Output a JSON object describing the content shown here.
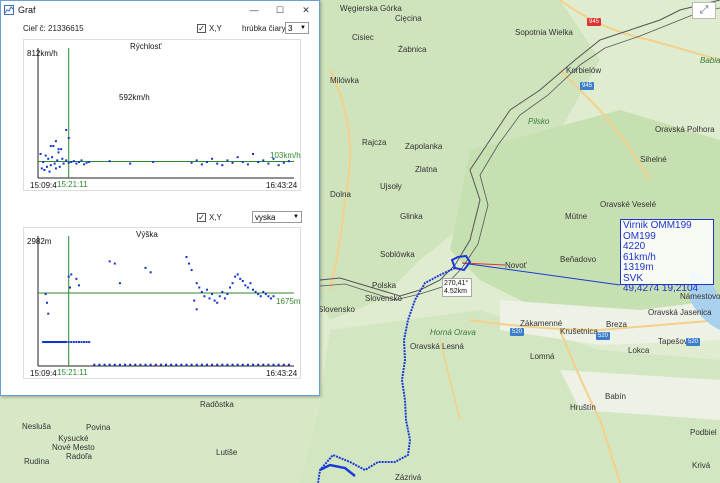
{
  "window": {
    "title": "Graf",
    "buttons": {
      "minimize": "—",
      "maximize": "☐",
      "close": "✕"
    }
  },
  "top_controls": {
    "target_label": "Cieľ č: 21336615",
    "xy_checkbox_label": "X,Y",
    "xy_checked": true,
    "line_width_label": "hrúbka čiary",
    "line_width_value": "3"
  },
  "speed_chart": {
    "title": "Rýchlosť",
    "ymax_label": "812km/h",
    "annotation": "592km/h",
    "ref_label": "103km/h",
    "x_start_label": "15:09:4",
    "x_cursor_label": "15:21:11",
    "x_end_label": "16:43:24"
  },
  "altitude_controls": {
    "xy_checkbox_label": "X,Y",
    "xy_checked": true,
    "quantity_value": "vyska"
  },
  "altitude_chart": {
    "title": "Výška",
    "ymax_label": "2982m",
    "ref_label": "1675m",
    "x_start_label": "15:09:4",
    "x_cursor_label": "15:21:11",
    "x_end_label": "16:43:24"
  },
  "chart_data": [
    {
      "type": "scatter",
      "title": "Rýchlosť",
      "xlabel": "",
      "ylabel": "",
      "x_range": [
        "15:09:4",
        "16:43:24"
      ],
      "ylim": [
        0,
        812
      ],
      "y_unit": "km/h",
      "reference_line_y": 103,
      "cursor_x": "15:21:11",
      "series": [
        {
          "color": "#1133cc",
          "x": [
            0.01,
            0.015,
            0.02,
            0.025,
            0.03,
            0.035,
            0.04,
            0.045,
            0.05,
            0.055,
            0.06,
            0.065,
            0.07,
            0.075,
            0.08,
            0.085,
            0.09,
            0.095,
            0.1,
            0.11,
            0.12,
            0.13,
            0.14,
            0.15,
            0.16,
            0.17,
            0.18,
            0.19,
            0.2,
            0.28,
            0.36,
            0.45,
            0.6,
            0.62,
            0.64,
            0.66,
            0.68,
            0.7,
            0.72,
            0.74,
            0.76,
            0.78,
            0.8,
            0.82,
            0.84,
            0.86,
            0.88,
            0.9,
            0.92,
            0.94,
            0.96,
            0.98,
            0.11,
            0.12,
            0.07,
            0.05,
            0.08
          ],
          "y": [
            150,
            60,
            100,
            50,
            140,
            70,
            120,
            40,
            80,
            130,
            200,
            90,
            60,
            110,
            160,
            70,
            180,
            120,
            90,
            110,
            95,
            100,
            105,
            90,
            100,
            110,
            85,
            95,
            100,
            105,
            90,
            100,
            95,
            110,
            85,
            100,
            120,
            90,
            80,
            110,
            95,
            130,
            100,
            85,
            150,
            100,
            110,
            90,
            120,
            80,
            95,
            105,
            300,
            250,
            230,
            200,
            180
          ]
        }
      ]
    },
    {
      "type": "scatter",
      "title": "Výška",
      "xlabel": "",
      "ylabel": "",
      "x_range": [
        "15:09:4",
        "16:43:24"
      ],
      "ylim": [
        0,
        2982
      ],
      "y_unit": "m",
      "reference_line_y": 1675,
      "cursor_x": "15:21:11",
      "series": [
        {
          "color": "#1133cc",
          "x": [
            0.02,
            0.025,
            0.03,
            0.035,
            0.04,
            0.045,
            0.05,
            0.055,
            0.06,
            0.065,
            0.07,
            0.075,
            0.08,
            0.085,
            0.09,
            0.095,
            0.1,
            0.105,
            0.11,
            0.12,
            0.13,
            0.14,
            0.15,
            0.16,
            0.17,
            0.18,
            0.19,
            0.2,
            0.22,
            0.24,
            0.26,
            0.28,
            0.3,
            0.32,
            0.34,
            0.36,
            0.38,
            0.4,
            0.42,
            0.44,
            0.46,
            0.48,
            0.5,
            0.52,
            0.54,
            0.56,
            0.58,
            0.6,
            0.62,
            0.64,
            0.66,
            0.68,
            0.7,
            0.72,
            0.74,
            0.76,
            0.78,
            0.8,
            0.82,
            0.84,
            0.86,
            0.88,
            0.9,
            0.92,
            0.94,
            0.96,
            0.98,
            0.03,
            0.035,
            0.04,
            0.12,
            0.125,
            0.13,
            0.28,
            0.3,
            0.32,
            0.42,
            0.44,
            0.58,
            0.59,
            0.6,
            0.61,
            0.62,
            0.15,
            0.16
          ],
          "y": [
            550,
            550,
            550,
            550,
            550,
            550,
            550,
            550,
            550,
            550,
            550,
            550,
            550,
            550,
            550,
            550,
            550,
            550,
            550,
            550,
            550,
            550,
            550,
            550,
            550,
            550,
            550,
            550,
            30,
            30,
            30,
            30,
            30,
            30,
            30,
            30,
            30,
            30,
            30,
            30,
            30,
            30,
            30,
            30,
            30,
            30,
            30,
            30,
            30,
            30,
            30,
            30,
            30,
            30,
            30,
            30,
            30,
            30,
            30,
            30,
            30,
            30,
            30,
            30,
            30,
            30,
            30,
            1650,
            1450,
            1200,
            2050,
            1800,
            2100,
            2400,
            2350,
            1900,
            2250,
            2150,
            2500,
            2350,
            2200,
            1500,
            1300,
            2000,
            1850
          ]
        },
        {
          "color": "#1133cc",
          "x": [
            0.62,
            0.63,
            0.64,
            0.65,
            0.66,
            0.67,
            0.68,
            0.69,
            0.7,
            0.71,
            0.72,
            0.73,
            0.74,
            0.75,
            0.76,
            0.77,
            0.78,
            0.79,
            0.8,
            0.81,
            0.82,
            0.83,
            0.84,
            0.85,
            0.86,
            0.87,
            0.88,
            0.89,
            0.9,
            0.91,
            0.92
          ],
          "y": [
            1900,
            1800,
            1700,
            1600,
            1750,
            1550,
            1650,
            1500,
            1450,
            1600,
            1700,
            1550,
            1650,
            1800,
            1900,
            2050,
            2100,
            2000,
            1950,
            1850,
            1800,
            1900,
            1750,
            1700,
            1650,
            1600,
            1700,
            1650,
            1600,
            1550,
            1600
          ]
        }
      ]
    }
  ],
  "map": {
    "labels": [
      {
        "text": "Węgierska\nGórka",
        "kind": "town"
      },
      {
        "text": "Cięcina",
        "kind": "town"
      },
      {
        "text": "Sopotnia\nWielka",
        "kind": "town"
      },
      {
        "text": "Cisiec",
        "kind": "town"
      },
      {
        "text": "Żabnica",
        "kind": "town"
      },
      {
        "text": "Milówka",
        "kind": "town"
      },
      {
        "text": "Korbielów",
        "kind": "town"
      },
      {
        "text": "Pilsko",
        "kind": "peak"
      },
      {
        "text": "Babia",
        "kind": "peak"
      },
      {
        "text": "Oravská\nPolhora",
        "kind": "town"
      },
      {
        "text": "Rajcza",
        "kind": "town"
      },
      {
        "text": "Zapolanka",
        "kind": "town"
      },
      {
        "text": "Zlatna",
        "kind": "town"
      },
      {
        "text": "Sihelné",
        "kind": "town"
      },
      {
        "text": "Ujsoły",
        "kind": "town"
      },
      {
        "text": "Dolna",
        "kind": "town"
      },
      {
        "text": "Oravské\nVeselé",
        "kind": "town"
      },
      {
        "text": "Mútne",
        "kind": "town"
      },
      {
        "text": "Glinka",
        "kind": "town"
      },
      {
        "text": "Soblówka",
        "kind": "town"
      },
      {
        "text": "Beňadovo",
        "kind": "town"
      },
      {
        "text": "Novoť",
        "kind": "town"
      },
      {
        "text": "Polska",
        "kind": "border"
      },
      {
        "text": "Slovensko",
        "kind": "border"
      },
      {
        "text": "Horná Orava",
        "kind": "region"
      },
      {
        "text": "Zákamenné",
        "kind": "town"
      },
      {
        "text": "Krušetnica",
        "kind": "town"
      },
      {
        "text": "Breza",
        "kind": "town"
      },
      {
        "text": "Oravská\nJasenica",
        "kind": "town"
      },
      {
        "text": "Námestovo",
        "kind": "town"
      },
      {
        "text": "Tapešovo",
        "kind": "town"
      },
      {
        "text": "Oravská Lesná",
        "kind": "town"
      },
      {
        "text": "Lomná",
        "kind": "town"
      },
      {
        "text": "Lokca",
        "kind": "town"
      },
      {
        "text": "Babín",
        "kind": "town"
      },
      {
        "text": "Hruštín",
        "kind": "town"
      },
      {
        "text": "Radôstka",
        "kind": "town"
      },
      {
        "text": "Nesluša",
        "kind": "town"
      },
      {
        "text": "Povina",
        "kind": "town"
      },
      {
        "text": "Kysucké\nNové Mesto",
        "kind": "town"
      },
      {
        "text": "Radoľa",
        "kind": "town"
      },
      {
        "text": "Rudina",
        "kind": "town"
      },
      {
        "text": "Lutiše",
        "kind": "town"
      },
      {
        "text": "Zázrivá",
        "kind": "town"
      },
      {
        "text": "Podbiel",
        "kind": "town"
      },
      {
        "text": "Krivá",
        "kind": "town"
      },
      {
        "text": "Slovensko",
        "kind": "border"
      }
    ],
    "road_badges": [
      "945",
      "945",
      "520",
      "520",
      "520"
    ],
    "controls": {
      "fullscreen": "⤢"
    },
    "aircraft": {
      "lines": [
        "Virnik OMM199",
        "OM199",
        "4220",
        "61km/h",
        "1319m",
        "SVK",
        "49,4274 19,2104"
      ]
    },
    "bearing": {
      "angle": "270,41°",
      "distance": "4.52km"
    },
    "colors": {
      "track": "#1a3ad6",
      "border_line": "#444444",
      "forest": "#c8e2b4"
    }
  }
}
